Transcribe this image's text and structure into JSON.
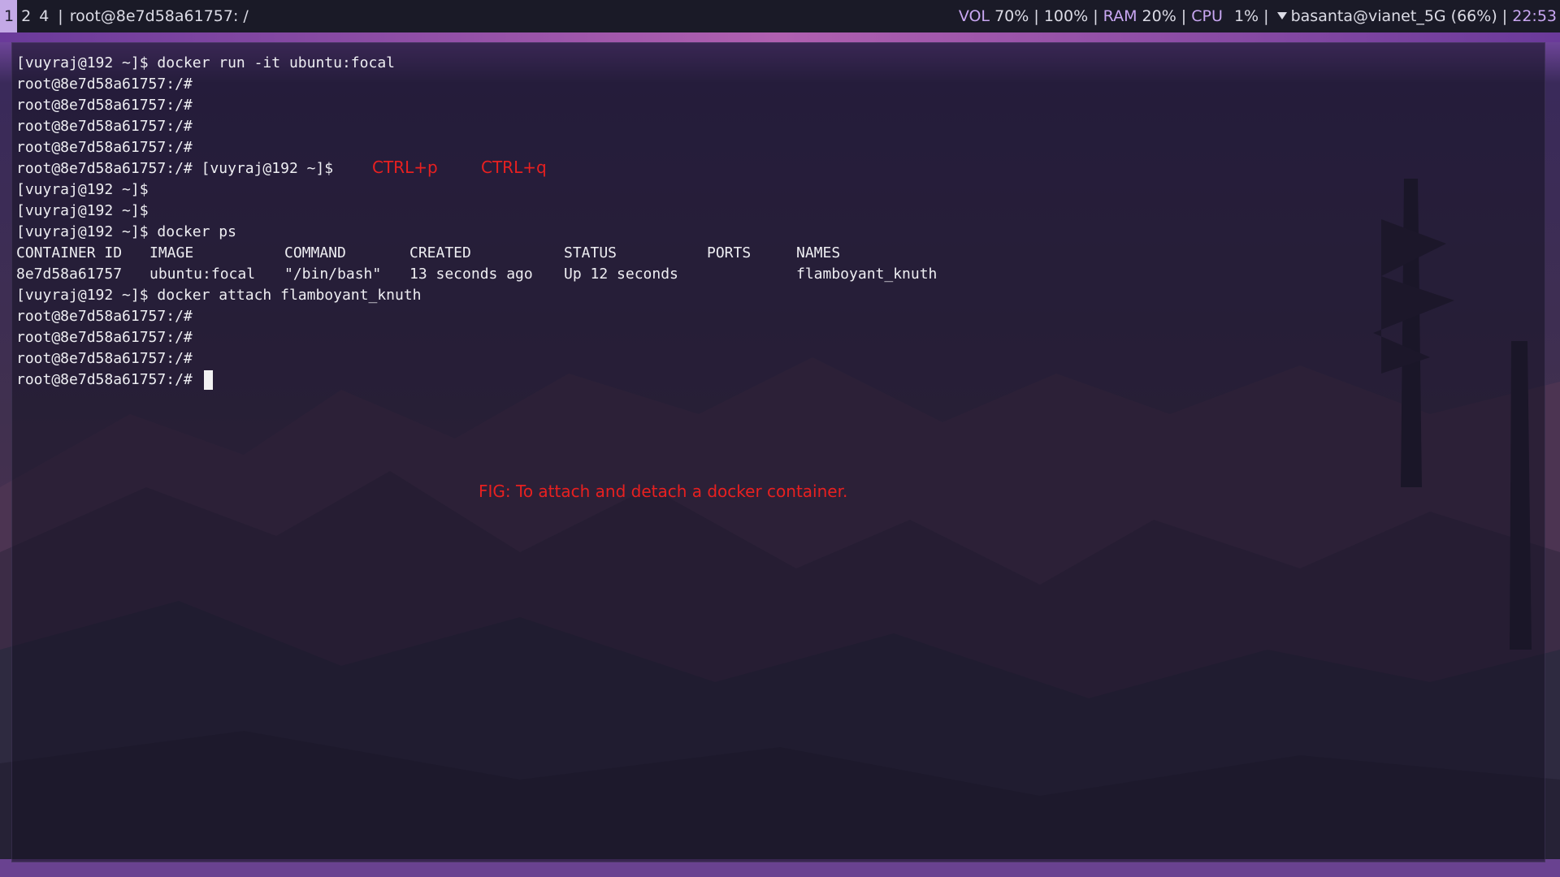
{
  "topbar": {
    "workspaces": [
      "1",
      "2",
      "4"
    ],
    "active_workspace": "1",
    "window_title": "root@8e7d58a61757: /",
    "vol_label": "VOL",
    "vol_value": "70%",
    "brightness": "100%",
    "ram_label": "RAM",
    "ram_value": "20%",
    "cpu_label": "CPU",
    "cpu_value": "1%",
    "wifi": "basanta@vianet_5G (66%)",
    "time": "22:53",
    "separator": "|"
  },
  "terminal": {
    "lines": [
      "[vuyraj@192 ~]$ docker run -it ubuntu:focal",
      "root@8e7d58a61757:/#",
      "root@8e7d58a61757:/#",
      "root@8e7d58a61757:/#",
      "root@8e7d58a61757:/#",
      "root@8e7d58a61757:/# [vuyraj@192 ~]$",
      "[vuyraj@192 ~]$",
      "[vuyraj@192 ~]$",
      "[vuyraj@192 ~]$ docker ps",
      "",
      "",
      "[vuyraj@192 ~]$ docker attach flamboyant_knuth",
      "root@8e7d58a61757:/#",
      "root@8e7d58a61757:/#",
      "root@8e7d58a61757:/#",
      "root@8e7d58a61757:/#"
    ],
    "ps_table": {
      "headers": [
        "CONTAINER ID",
        "IMAGE",
        "COMMAND",
        "CREATED",
        "STATUS",
        "PORTS",
        "NAMES"
      ],
      "rows": [
        [
          "8e7d58a61757",
          "ubuntu:focal",
          "\"/bin/bash\"",
          "13 seconds ago",
          "Up 12 seconds",
          "",
          "flamboyant_knuth"
        ]
      ]
    }
  },
  "annotations": {
    "ctrl_p": "CTRL+p",
    "ctrl_q": "CTRL+q",
    "caption": "FIG: To attach and detach a docker container."
  },
  "colors": {
    "annotation": "#e82020",
    "accent": "#c9a7f2",
    "terminal_text": "#eeeef2"
  }
}
